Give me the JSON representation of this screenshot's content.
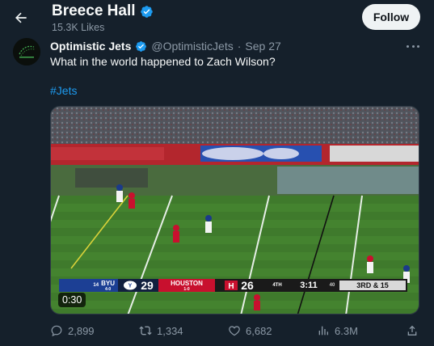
{
  "header": {
    "profile_name": "Breece Hall",
    "likes_count": "15.3K Likes",
    "follow_label": "Follow"
  },
  "tweet": {
    "author_name": "Optimistic Jets",
    "handle": "@OptimisticJets",
    "separator": "·",
    "date": "Sep 27",
    "text": "What in the world happened to Zach Wilson?",
    "hashtag": "#Jets",
    "video": {
      "duration": "0:30",
      "scorebug": {
        "team1_rank": "14",
        "team1_name": "BYU",
        "team1_record": "4-0",
        "team1_score": "29",
        "team2_name": "HOUSTON",
        "team2_record": "1-0",
        "team2_score": "26",
        "quarter": "4TH",
        "clock": "3:11",
        "play_clock": "40",
        "down_distance": "3RD & 15"
      }
    },
    "actions": {
      "replies": "2,899",
      "retweets": "1,334",
      "likes": "6,682",
      "views": "6.3M"
    }
  },
  "colors": {
    "background": "#15202b",
    "accent": "#1d9bf0",
    "secondary_text": "#8b98a5"
  }
}
